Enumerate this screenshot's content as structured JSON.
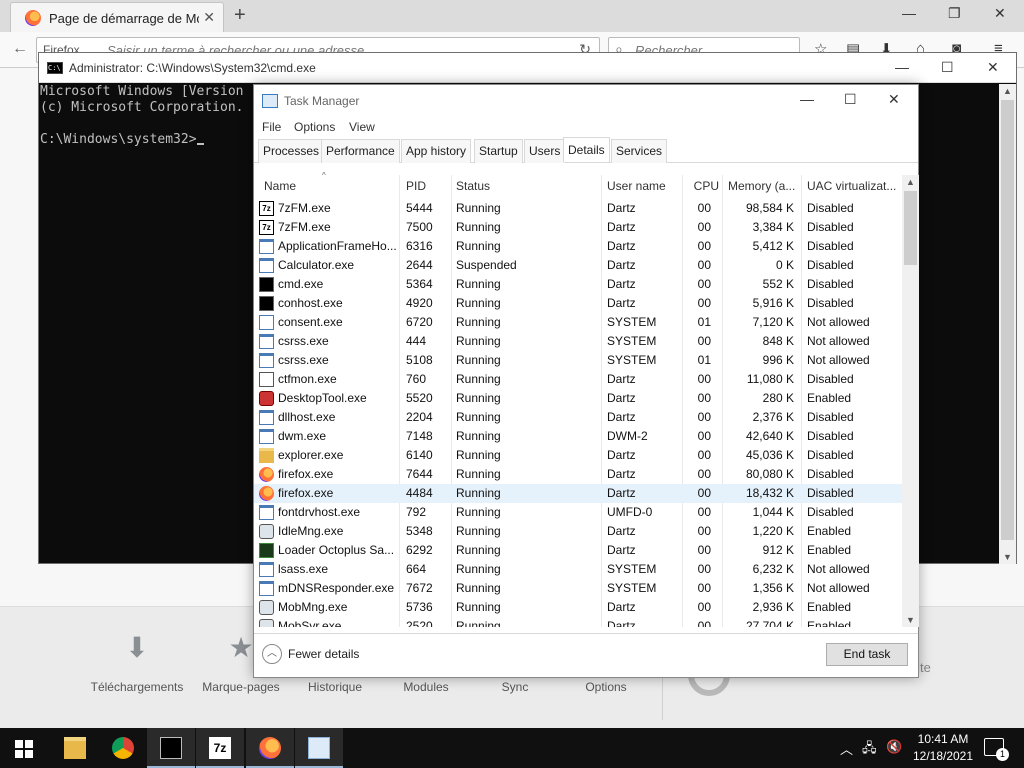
{
  "firefox": {
    "tab_title": "Page de démarrage de Mo...",
    "url_identity": "Firefox",
    "url_placeholder": "Saisir un terme à rechercher ou une adresse",
    "search_placeholder": "Rechercher",
    "tiles": [
      "Téléchargements",
      "Marque-pages",
      "Historique",
      "Modules",
      "Sync",
      "Options"
    ],
    "partial_text": "te"
  },
  "cmd": {
    "title": "Administrator: C:\\Windows\\System32\\cmd.exe",
    "lines": [
      "Microsoft Windows [Version",
      "(c) Microsoft Corporation.",
      "",
      "C:\\Windows\\system32>"
    ]
  },
  "taskmgr": {
    "title": "Task Manager",
    "menu": [
      "File",
      "Options",
      "View"
    ],
    "tabs": [
      "Processes",
      "Performance",
      "App history",
      "Startup",
      "Users",
      "Details",
      "Services"
    ],
    "active_tab": "Details",
    "columns": [
      "Name",
      "PID",
      "Status",
      "User name",
      "CPU",
      "Memory (a...",
      "UAC virtualizat..."
    ],
    "rows": [
      {
        "name": "7zFM.exe",
        "pid": "5444",
        "status": "Running",
        "user": "Dartz",
        "cpu": "00",
        "mem": "98,584 K",
        "uac": "Disabled",
        "icon": "7z-icon"
      },
      {
        "name": "7zFM.exe",
        "pid": "7500",
        "status": "Running",
        "user": "Dartz",
        "cpu": "00",
        "mem": "3,384 K",
        "uac": "Disabled",
        "icon": "7z-icon"
      },
      {
        "name": "ApplicationFrameHo...",
        "pid": "6316",
        "status": "Running",
        "user": "Dartz",
        "cpu": "00",
        "mem": "5,412 K",
        "uac": "Disabled",
        "icon": "window-icon"
      },
      {
        "name": "Calculator.exe",
        "pid": "2644",
        "status": "Suspended",
        "user": "Dartz",
        "cpu": "00",
        "mem": "0 K",
        "uac": "Disabled",
        "icon": "window-icon"
      },
      {
        "name": "cmd.exe",
        "pid": "5364",
        "status": "Running",
        "user": "Dartz",
        "cpu": "00",
        "mem": "552 K",
        "uac": "Disabled",
        "icon": "console-icon"
      },
      {
        "name": "conhost.exe",
        "pid": "4920",
        "status": "Running",
        "user": "Dartz",
        "cpu": "00",
        "mem": "5,916 K",
        "uac": "Disabled",
        "icon": "console-icon"
      },
      {
        "name": "consent.exe",
        "pid": "6720",
        "status": "Running",
        "user": "SYSTEM",
        "cpu": "01",
        "mem": "7,120 K",
        "uac": "Not allowed",
        "icon": "blank-window-icon"
      },
      {
        "name": "csrss.exe",
        "pid": "444",
        "status": "Running",
        "user": "SYSTEM",
        "cpu": "00",
        "mem": "848 K",
        "uac": "Not allowed",
        "icon": "window-icon"
      },
      {
        "name": "csrss.exe",
        "pid": "5108",
        "status": "Running",
        "user": "SYSTEM",
        "cpu": "01",
        "mem": "996 K",
        "uac": "Not allowed",
        "icon": "window-icon"
      },
      {
        "name": "ctfmon.exe",
        "pid": "760",
        "status": "Running",
        "user": "Dartz",
        "cpu": "00",
        "mem": "11,080 K",
        "uac": "Disabled",
        "icon": "pen-icon"
      },
      {
        "name": "DesktopTool.exe",
        "pid": "5520",
        "status": "Running",
        "user": "Dartz",
        "cpu": "00",
        "mem": "280 K",
        "uac": "Enabled",
        "icon": "tool-icon"
      },
      {
        "name": "dllhost.exe",
        "pid": "2204",
        "status": "Running",
        "user": "Dartz",
        "cpu": "00",
        "mem": "2,376 K",
        "uac": "Disabled",
        "icon": "window-icon"
      },
      {
        "name": "dwm.exe",
        "pid": "7148",
        "status": "Running",
        "user": "DWM-2",
        "cpu": "00",
        "mem": "42,640 K",
        "uac": "Disabled",
        "icon": "window-icon"
      },
      {
        "name": "explorer.exe",
        "pid": "6140",
        "status": "Running",
        "user": "Dartz",
        "cpu": "00",
        "mem": "45,036 K",
        "uac": "Disabled",
        "icon": "folder-icon"
      },
      {
        "name": "firefox.exe",
        "pid": "7644",
        "status": "Running",
        "user": "Dartz",
        "cpu": "00",
        "mem": "80,080 K",
        "uac": "Disabled",
        "icon": "firefox-icon"
      },
      {
        "name": "firefox.exe",
        "pid": "4484",
        "status": "Running",
        "user": "Dartz",
        "cpu": "00",
        "mem": "18,432 K",
        "uac": "Disabled",
        "icon": "firefox-icon"
      },
      {
        "name": "fontdrvhost.exe",
        "pid": "792",
        "status": "Running",
        "user": "UMFD-0",
        "cpu": "00",
        "mem": "1,044 K",
        "uac": "Disabled",
        "icon": "window-icon"
      },
      {
        "name": "IdleMng.exe",
        "pid": "5348",
        "status": "Running",
        "user": "Dartz",
        "cpu": "00",
        "mem": "1,220 K",
        "uac": "Enabled",
        "icon": "gear-icon"
      },
      {
        "name": "Loader Octoplus Sa...",
        "pid": "6292",
        "status": "Running",
        "user": "Dartz",
        "cpu": "00",
        "mem": "912 K",
        "uac": "Enabled",
        "icon": "loader-icon"
      },
      {
        "name": "lsass.exe",
        "pid": "664",
        "status": "Running",
        "user": "SYSTEM",
        "cpu": "00",
        "mem": "6,232 K",
        "uac": "Not allowed",
        "icon": "window-icon"
      },
      {
        "name": "mDNSResponder.exe",
        "pid": "7672",
        "status": "Running",
        "user": "SYSTEM",
        "cpu": "00",
        "mem": "1,356 K",
        "uac": "Not allowed",
        "icon": "window-icon"
      },
      {
        "name": "MobMng.exe",
        "pid": "5736",
        "status": "Running",
        "user": "Dartz",
        "cpu": "00",
        "mem": "2,936 K",
        "uac": "Enabled",
        "icon": "gear-icon"
      },
      {
        "name": "MobSvr.exe",
        "pid": "2520",
        "status": "Running",
        "user": "Dartz",
        "cpu": "00",
        "mem": "27,704 K",
        "uac": "Enabled",
        "icon": "gear-icon"
      }
    ],
    "selected_row": 15,
    "fewer_details": "Fewer details",
    "end_task": "End task"
  },
  "taskbar": {
    "time": "10:41 AM",
    "date": "12/18/2021",
    "notifications": "1",
    "apps": [
      "file-explorer",
      "chrome",
      "cmd",
      "7zip",
      "firefox",
      "task-manager"
    ]
  }
}
